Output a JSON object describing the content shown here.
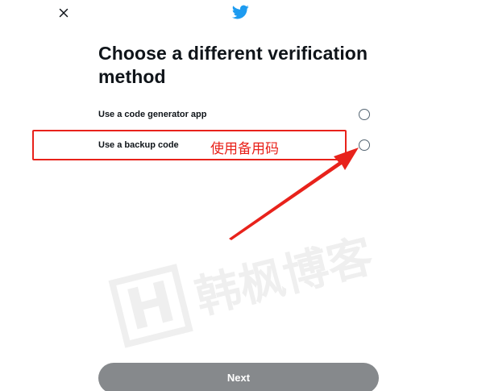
{
  "header": {
    "close_icon": "close-icon",
    "logo_icon": "twitter-bird-icon"
  },
  "title": "Choose a different verification method",
  "options": [
    {
      "label": "Use a code generator app",
      "selected": false
    },
    {
      "label": "Use a backup code",
      "selected": false
    }
  ],
  "annotation": {
    "text": "使用备用码",
    "color": "#e8221b"
  },
  "watermark": {
    "logo": "H",
    "text": "韩枫博客"
  },
  "footer": {
    "next_label": "Next"
  },
  "colors": {
    "brand": "#1d9bf0",
    "button_disabled": "#86898c",
    "text": "#0f1419",
    "radio_border": "#536471"
  }
}
